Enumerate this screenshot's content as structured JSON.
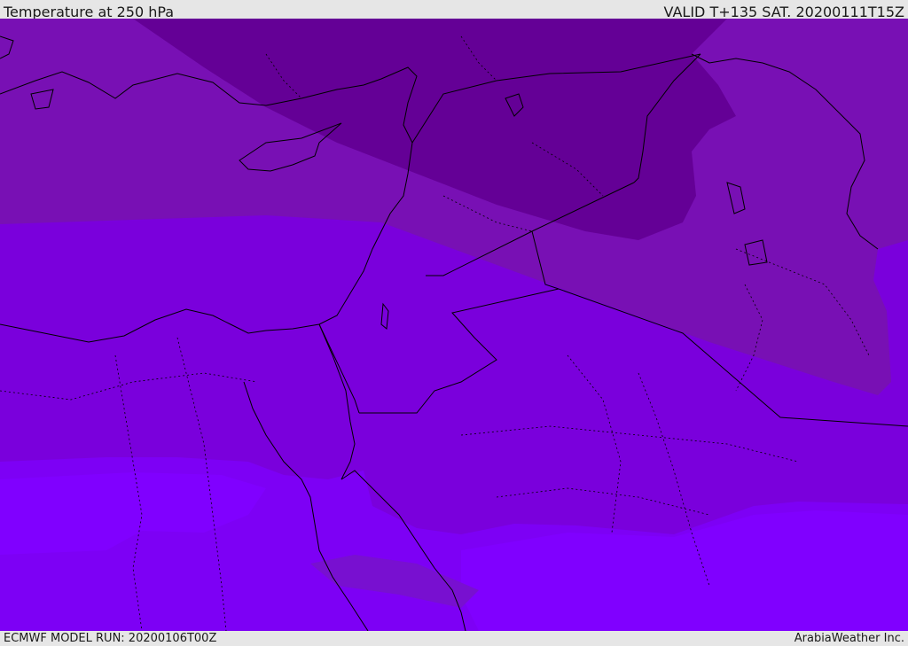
{
  "header": {
    "title": "Temperature at 250 hPa",
    "valid": "VALID T+135 SAT. 20200111T15Z"
  },
  "footer": {
    "model_run": "ECMWF MODEL RUN: 20200106T00Z",
    "credit": "ArabiaWeather Inc."
  },
  "colors": {
    "band_darkest": "#640096",
    "band_dark": "#7810b4",
    "band_mid": "#7a00dc",
    "band_light": "#7d00f5",
    "band_lightest": "#8000ff",
    "border": "#000000"
  }
}
